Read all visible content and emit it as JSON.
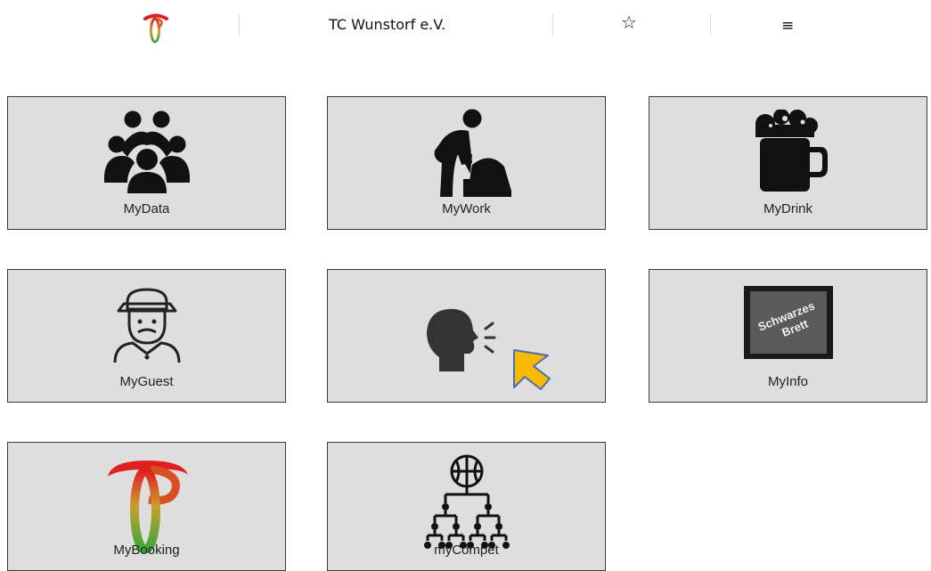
{
  "header": {
    "title": "TC Wunstorf e.V.",
    "logo_icon": "tc-wunstorf-logo",
    "star_icon": "☆",
    "menu_icon": "≡"
  },
  "tiles": [
    {
      "label": "MyData",
      "icon": "people-group-icon"
    },
    {
      "label": "MyWork",
      "icon": "worker-shovel-icon"
    },
    {
      "label": "MyDrink",
      "icon": "beer-mug-icon"
    },
    {
      "label": "MyGuest",
      "icon": "guest-hat-icon"
    },
    {
      "label": "",
      "icon": "speaking-head-icon"
    },
    {
      "label": "MyInfo",
      "icon": "schwarzes-brett-board-icon",
      "board_text": [
        "Schwarzes",
        "Brett"
      ]
    },
    {
      "label": "MyBooking",
      "icon": "tc-wunstorf-logo"
    },
    {
      "label": "myCompet",
      "icon": "tournament-bracket-icon"
    }
  ],
  "cursor_icon": "pointer-arrow-icon",
  "colors": {
    "tile_bg": "#dedede",
    "tile_border": "#3a3a3a",
    "logo_red": "#e02020",
    "logo_green": "#3aa63a",
    "cursor": "#f9b900"
  }
}
